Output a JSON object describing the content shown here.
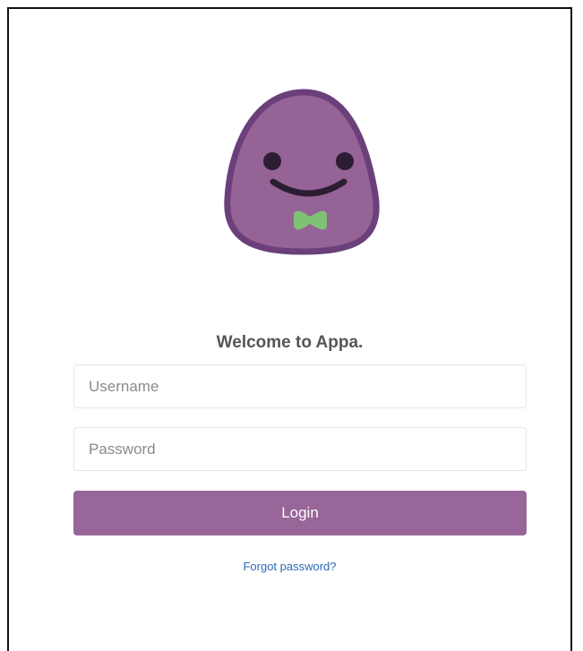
{
  "mascot": {
    "icon": "appa-mascot-icon",
    "colors": {
      "body": "#956396",
      "outline": "#6b3f7a",
      "eyes": "#2c1d33",
      "smile": "#2c1d33",
      "bowtie": "#7fc275"
    }
  },
  "login": {
    "welcome": "Welcome to Appa.",
    "username_placeholder": "Username",
    "username_value": "",
    "password_placeholder": "Password",
    "password_value": "",
    "login_label": "Login",
    "forgot_label": "Forgot password?"
  },
  "colors": {
    "accent": "#996699",
    "link": "#2a6ab4",
    "heading": "#555555",
    "field_border": "#e6e6e6"
  }
}
